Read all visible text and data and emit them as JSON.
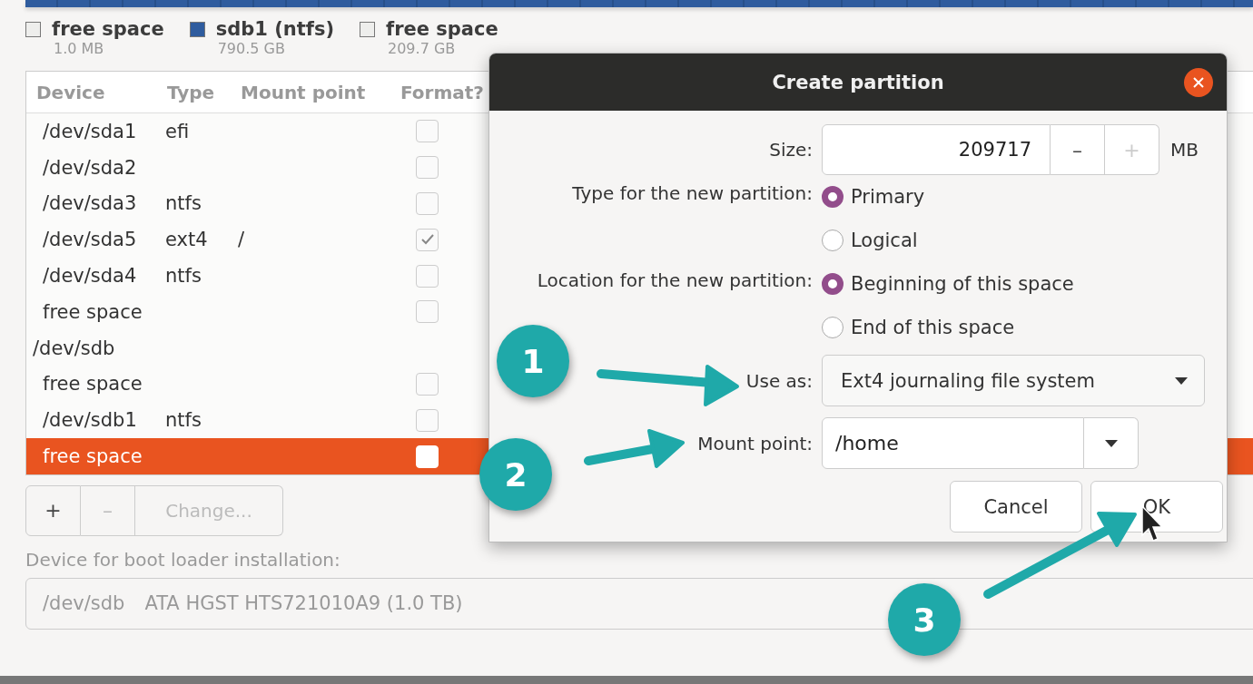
{
  "legend": [
    {
      "name": "free space",
      "size": "1.0 MB",
      "color": "#eeeeec"
    },
    {
      "name": "sdb1 (ntfs)",
      "size": "790.5 GB",
      "color": "#2f5c9e"
    },
    {
      "name": "free space",
      "size": "209.7 GB",
      "color": "#eeeeec"
    }
  ],
  "table": {
    "columns": [
      "Device",
      "Type",
      "Mount point",
      "Format?"
    ],
    "groups": [
      {
        "rows": [
          {
            "device": "/dev/sda1",
            "type": "efi",
            "format": false,
            "selected": false
          },
          {
            "device": "/dev/sda2",
            "format": false,
            "selected": false
          },
          {
            "device": "/dev/sda3",
            "type": "ntfs",
            "format": false,
            "selected": false
          },
          {
            "device": "/dev/sda5",
            "type": "ext4",
            "mount_point": "/",
            "format": true,
            "selected": false
          },
          {
            "device": "/dev/sda4",
            "type": "ntfs",
            "format": false,
            "selected": false
          },
          {
            "device": "free space",
            "format": false,
            "selected": false
          }
        ]
      },
      {
        "device": "/dev/sdb",
        "rows": [
          {
            "device": "free space",
            "format": false,
            "selected": false
          },
          {
            "device": "/dev/sdb1",
            "type": "ntfs",
            "format": false,
            "selected": false
          },
          {
            "device": "free space",
            "format": false,
            "selected": true
          }
        ]
      }
    ]
  },
  "table_buttons": [
    {
      "label": "+",
      "disabled": false
    },
    {
      "label": "–",
      "disabled": true
    },
    {
      "label": "Change...",
      "disabled": true
    }
  ],
  "boot_loader": {
    "label": "Device for boot loader installation:",
    "device": "/dev/sdb",
    "description": "ATA HGST HTS721010A9 (1.0 TB)",
    "disabled": true
  },
  "dialog": {
    "title": "Create partition",
    "size": {
      "label": "Size:",
      "value": "209717",
      "unit": "MB",
      "buttons": [
        {
          "label": "–",
          "disabled": false
        },
        {
          "label": "+",
          "disabled": true
        }
      ]
    },
    "type": {
      "label": "Type for the new partition:",
      "options": [
        {
          "label": "Primary",
          "selected": true
        },
        {
          "label": "Logical",
          "selected": false
        }
      ]
    },
    "location": {
      "label": "Location for the new partition:",
      "options": [
        {
          "label": "Beginning of this space",
          "selected": true
        },
        {
          "label": "End of this space",
          "selected": false
        }
      ]
    },
    "use_as": {
      "label": "Use as:",
      "value": "Ext4 journaling file system"
    },
    "mount_point": {
      "label": "Mount point:",
      "value": "/home"
    },
    "buttons": [
      "Cancel",
      "OK"
    ]
  },
  "annotations": [
    {
      "number": "1"
    },
    {
      "number": "2"
    },
    {
      "number": "3"
    }
  ]
}
